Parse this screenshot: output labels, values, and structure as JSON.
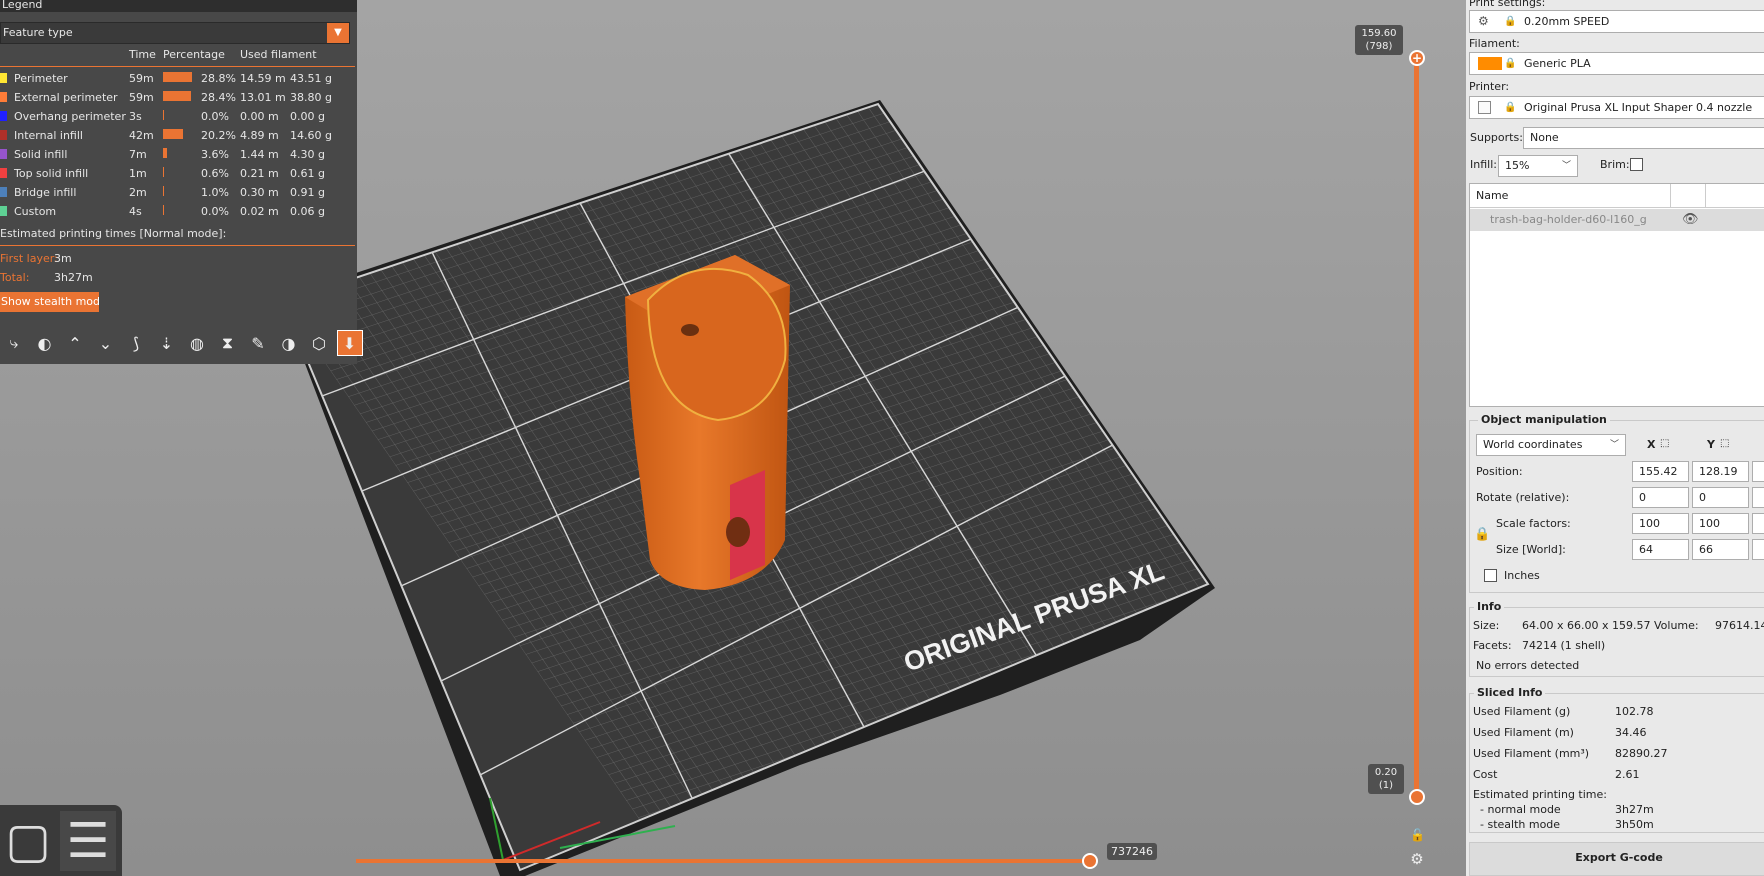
{
  "legend": {
    "title": "Legend",
    "feature_type": "Feature type",
    "headers": {
      "time": "Time",
      "percentage": "Percentage",
      "used_filament": "Used filament"
    },
    "features": [
      {
        "name": "Perimeter",
        "color": "#ffe633",
        "time": "59m",
        "pct_value": 28.8,
        "pct": "28.8%",
        "length": "14.59 m",
        "weight": "43.51 g"
      },
      {
        "name": "External perimeter",
        "color": "#ff7d38",
        "time": "59m",
        "pct_value": 28.4,
        "pct": "28.4%",
        "length": "13.01 m",
        "weight": "38.80 g"
      },
      {
        "name": "Overhang perimeter",
        "color": "#1f1fff",
        "time": "3s",
        "pct_value": 0.0,
        "pct": "0.0%",
        "length": "0.00 m",
        "weight": "0.00 g"
      },
      {
        "name": "Internal infill",
        "color": "#b03029",
        "time": "42m",
        "pct_value": 20.2,
        "pct": "20.2%",
        "length": "4.89 m",
        "weight": "14.60 g"
      },
      {
        "name": "Solid infill",
        "color": "#9654cc",
        "time": "7m",
        "pct_value": 3.6,
        "pct": "3.6%",
        "length": "1.44 m",
        "weight": "4.30 g"
      },
      {
        "name": "Top solid infill",
        "color": "#f04040",
        "time": "1m",
        "pct_value": 0.6,
        "pct": "0.6%",
        "length": "0.21 m",
        "weight": "0.61 g"
      },
      {
        "name": "Bridge infill",
        "color": "#4d80ba",
        "time": "2m",
        "pct_value": 1.0,
        "pct": "1.0%",
        "length": "0.30 m",
        "weight": "0.91 g"
      },
      {
        "name": "Custom",
        "color": "#5ed194",
        "time": "4s",
        "pct_value": 0.0,
        "pct": "0.0%",
        "length": "0.02 m",
        "weight": "0.06 g"
      }
    ],
    "estimated_title": "Estimated printing times [Normal mode]:",
    "first_layer_label": "First layer:",
    "first_layer_value": "3m",
    "total_label": "Total:",
    "total_value": "3h27m",
    "stealth_button": "Show stealth mode"
  },
  "toolbar_icons": [
    "travel-icon",
    "wipe-icon",
    "retractions-icon",
    "deretractions-icon",
    "seams-icon",
    "tool-changes-icon",
    "color-changes-icon",
    "pause-prints-icon",
    "custom-gcode-icon",
    "center-of-gravity-icon",
    "shells-icon",
    "tool-marker-icon"
  ],
  "bed_label": "ORIGINAL PRUSA XL",
  "vertical_slider": {
    "top_value": "159.60",
    "top_layer": "(798)",
    "bottom_value": "0.20",
    "bottom_layer": "(1)"
  },
  "horizontal_slider": {
    "value": "737246",
    "position_fraction": 1.0
  },
  "right_panel": {
    "print_settings_label": "Print settings:",
    "print_settings_value": "0.20mm SPEED",
    "filament_label": "Filament:",
    "filament_value": "Generic PLA",
    "filament_color": "#ff8c00",
    "printer_label": "Printer:",
    "printer_value": "Original Prusa XL Input Shaper 0.4 nozzle",
    "supports_label": "Supports:",
    "supports_value": "None",
    "infill_label": "Infill:",
    "infill_value": "15%",
    "brim_label": "Brim:",
    "list_header": "Name",
    "object_name": "trash-bag-holder-d60-l160_g",
    "object_manipulation": {
      "title": "Object manipulation",
      "coord_system": "World coordinates",
      "x_label": "X",
      "y_label": "Y",
      "position_label": "Position:",
      "position": [
        "155.42",
        "128.19"
      ],
      "rotate_label": "Rotate (relative):",
      "rotate": [
        "0",
        "0"
      ],
      "scale_label": "Scale factors:",
      "scale": [
        "100",
        "100"
      ],
      "size_label": "Size [World]:",
      "size": [
        "64",
        "66"
      ],
      "inches_label": "Inches"
    },
    "info": {
      "title": "Info",
      "size_label": "Size:",
      "size_value": "64.00 x 66.00 x 159.57",
      "volume_label": "Volume:",
      "volume_value": "97614.14",
      "facets_label": "Facets:",
      "facets_value": "74214 (1 shell)",
      "errors": "No errors detected"
    },
    "sliced_info": {
      "title": "Sliced Info",
      "rows": [
        {
          "label": "Used Filament (g)",
          "value": "102.78"
        },
        {
          "label": "Used Filament (m)",
          "value": "34.46"
        },
        {
          "label": "Used Filament (mm³)",
          "value": "82890.27"
        },
        {
          "label": "Cost",
          "value": "2.61"
        }
      ],
      "est_label": "Estimated printing time:",
      "normal_label": "- normal mode",
      "normal_value": "3h27m",
      "stealth_label": "- stealth mode",
      "stealth_value": "3h50m"
    },
    "export_button": "Export G-code"
  }
}
